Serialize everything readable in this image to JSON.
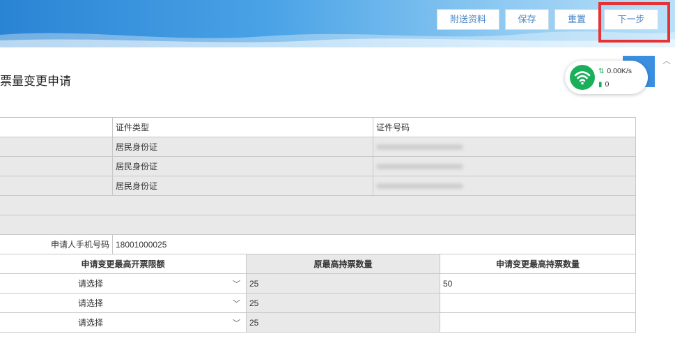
{
  "toolbar": {
    "attach_label": "附送资料",
    "save_label": "保存",
    "reset_label": "重置",
    "next_label": "下一步"
  },
  "page": {
    "title": "票量变更申请"
  },
  "network": {
    "speed": "0.00K/s",
    "count": "0"
  },
  "ids_table": {
    "header_type": "证件类型",
    "header_number": "证件号码",
    "rows": [
      {
        "type": "居民身份证"
      },
      {
        "type": "居民身份证"
      },
      {
        "type": "居民身份证"
      }
    ]
  },
  "phone": {
    "label": "申请人手机号码",
    "value": "18001000025"
  },
  "quota_table": {
    "headers": [
      "申请变更最高开票限额",
      "原最高持票数量",
      "申请变更最高持票数量"
    ],
    "rows": [
      {
        "select": "请选择",
        "original": "25",
        "requested": "50"
      },
      {
        "select": "请选择",
        "original": "25",
        "requested": ""
      },
      {
        "select": "请选择",
        "original": "25",
        "requested": ""
      }
    ]
  },
  "colors": {
    "highlight": "#e53335",
    "button_text": "#4a86c5",
    "network_green": "#1ab05a"
  }
}
